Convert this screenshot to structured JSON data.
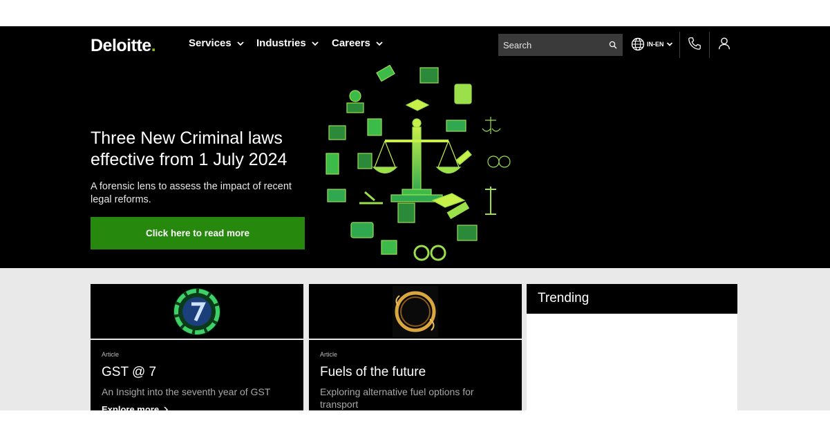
{
  "brand": {
    "name": "Deloitte",
    "dot": ".",
    "accent": "#86bc25"
  },
  "nav": [
    {
      "label": "Services"
    },
    {
      "label": "Industries"
    },
    {
      "label": "Careers"
    }
  ],
  "search": {
    "placeholder": "Search"
  },
  "locale": {
    "label": "IN-EN"
  },
  "hero": {
    "title": "Three New Criminal laws effective from 1 July 2024",
    "subtitle": "A forensic lens to assess the impact of recent legal reforms.",
    "cta_label": "Click here to read more",
    "cta_color": "#26890d"
  },
  "cards": [
    {
      "type": "Article",
      "title": "GST @ 7",
      "description": "An Insight into the seventh year of GST",
      "link": "Explore more"
    },
    {
      "type": "Article",
      "title": "Fuels of the future",
      "description": "Exploring alternative fuel options for transport"
    }
  ],
  "trending": {
    "title": "Trending"
  },
  "icons": [
    "search-icon",
    "globe-icon",
    "chevron-down-icon",
    "phone-icon",
    "user-icon",
    "legal-illustration"
  ]
}
